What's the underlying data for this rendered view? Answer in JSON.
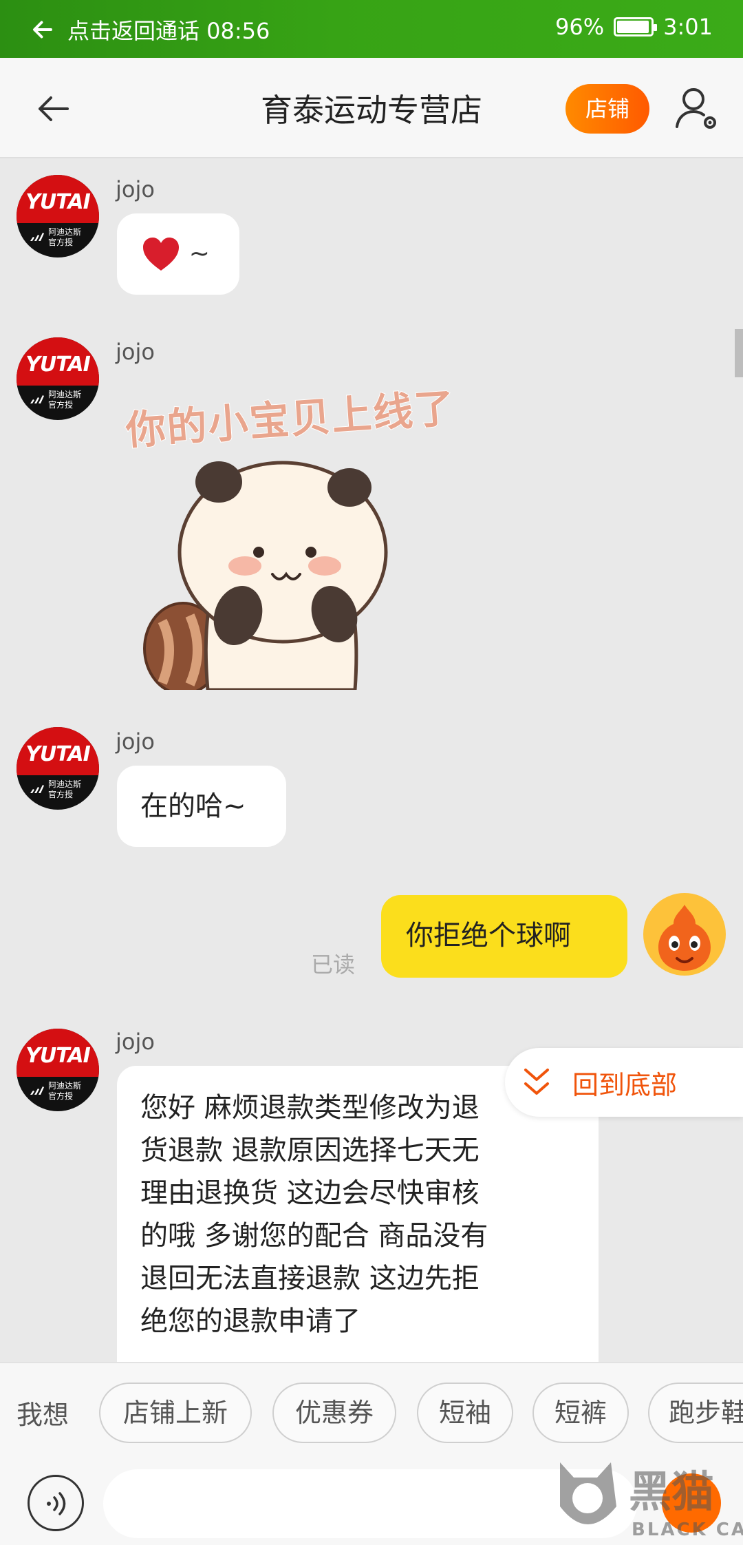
{
  "status_bar": {
    "call_text": "点击返回通话 08:56",
    "battery": "96%",
    "battery_level": 0.96,
    "time": "3:01"
  },
  "header": {
    "title": "育泰运动专营店",
    "shop_button": "店铺"
  },
  "messages": [
    {
      "sender": "jojo",
      "text": "❤️ ~"
    },
    {
      "sender": "jojo",
      "sticker_caption": "你的小宝贝上线了"
    },
    {
      "sender": "jojo",
      "text": "在的哈~"
    },
    {
      "sender": "me",
      "text": "你拒绝个球啊",
      "status": "已读"
    },
    {
      "sender": "jojo",
      "lines": [
        "您好 麻烦退款类型修改为退",
        "货退款 退款原因选择七天无",
        "理由退换货 这边会尽快审核",
        "的哦 多谢您的配合 商品没有",
        "退回无法直接退款 这边先拒",
        "绝您的退款申请了"
      ]
    }
  ],
  "avatar": {
    "logo_text": "YUTAI",
    "logo_sub": [
      "阿迪达斯",
      "官方授"
    ]
  },
  "go_bottom": "回到底部",
  "quick": {
    "label": "我想",
    "chips": [
      "店铺上新",
      "优惠券",
      "短袖",
      "短裤",
      "跑步鞋"
    ]
  },
  "input": {
    "placeholder": ""
  },
  "watermark": {
    "text": "黑猫",
    "sub": "BLACK CAT"
  },
  "colors": {
    "accent": "#ff6a00",
    "my_bubble": "#fbde1c",
    "status_bar": "#37a315"
  }
}
